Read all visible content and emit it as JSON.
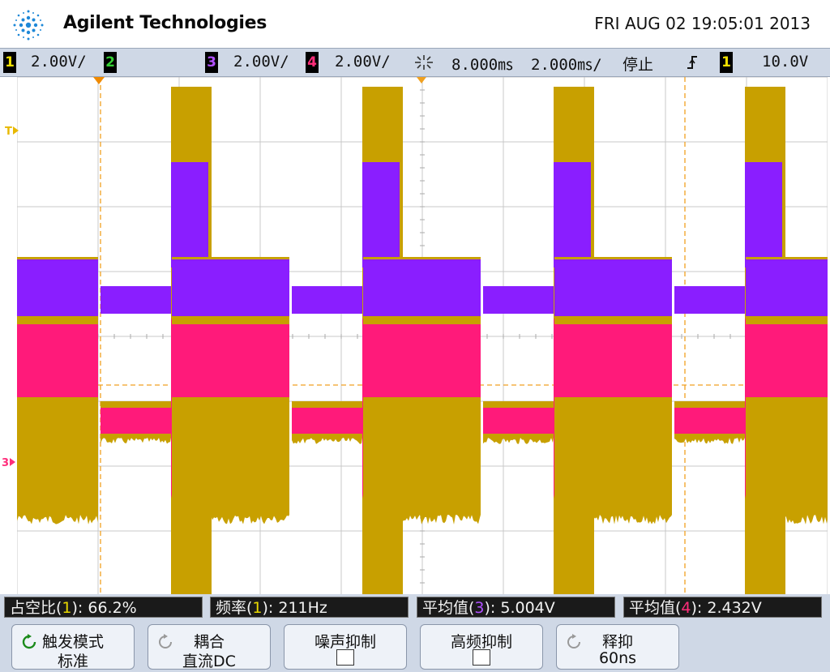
{
  "header": {
    "brand": "Agilent Technologies",
    "datetime": "FRI AUG 02 19:05:01 2013"
  },
  "channel_bar": {
    "ch1": {
      "num": "1",
      "scale": "2.00V/",
      "color": "#f0e000"
    },
    "ch2": {
      "num": "2",
      "color": "#35d035"
    },
    "ch3": {
      "num": "3",
      "scale": "2.00V/",
      "color": "#8a2be2"
    },
    "ch4": {
      "num": "4",
      "scale": "2.00V/",
      "color": "#ff2d7a"
    },
    "time_icon": "timebase-icon",
    "delay": "8.000㎳",
    "timebase": "2.000㎳/",
    "run_state": "停止",
    "trigger_icon": "trigger-edge-icon",
    "trigger_source": "1",
    "trigger_level": "10.0V"
  },
  "markers": {
    "trigger_marker": "T",
    "ground_marker": "3"
  },
  "measurements": [
    {
      "label": "占空比(",
      "ch": "1",
      "rest": "): 66.2%",
      "ch_color": "#e8d800"
    },
    {
      "label": "频率(",
      "ch": "1",
      "rest": "): 211Hz",
      "ch_color": "#e8d800"
    },
    {
      "label": "平均值(",
      "ch": "3",
      "rest": "): 5.004V",
      "ch_color": "#9b30ff"
    },
    {
      "label": "平均值(",
      "ch": "4",
      "rest": "): 2.432V",
      "ch_color": "#ff2d7a"
    }
  ],
  "softkeys": [
    {
      "line1": "触发模式",
      "line2": "标准",
      "icon": "rotate-knob-icon"
    },
    {
      "line1": "耦合",
      "line2": "直流DC",
      "icon": "rotate-knob-icon"
    },
    {
      "line1": "噪声抑制",
      "line2": "",
      "icon": "checkbox-icon"
    },
    {
      "line1": "高频抑制",
      "line2": "",
      "icon": "checkbox-icon"
    },
    {
      "line1": "释抑",
      "line2": "60ns",
      "icon": "rotate-knob-icon"
    }
  ],
  "colors": {
    "trace_yellow": "#c8a000",
    "trace_purple": "#8a1eff",
    "trace_pink": "#ff1a7a",
    "grid": "#c8c8c8",
    "cursor_orange": "#f0a020"
  }
}
